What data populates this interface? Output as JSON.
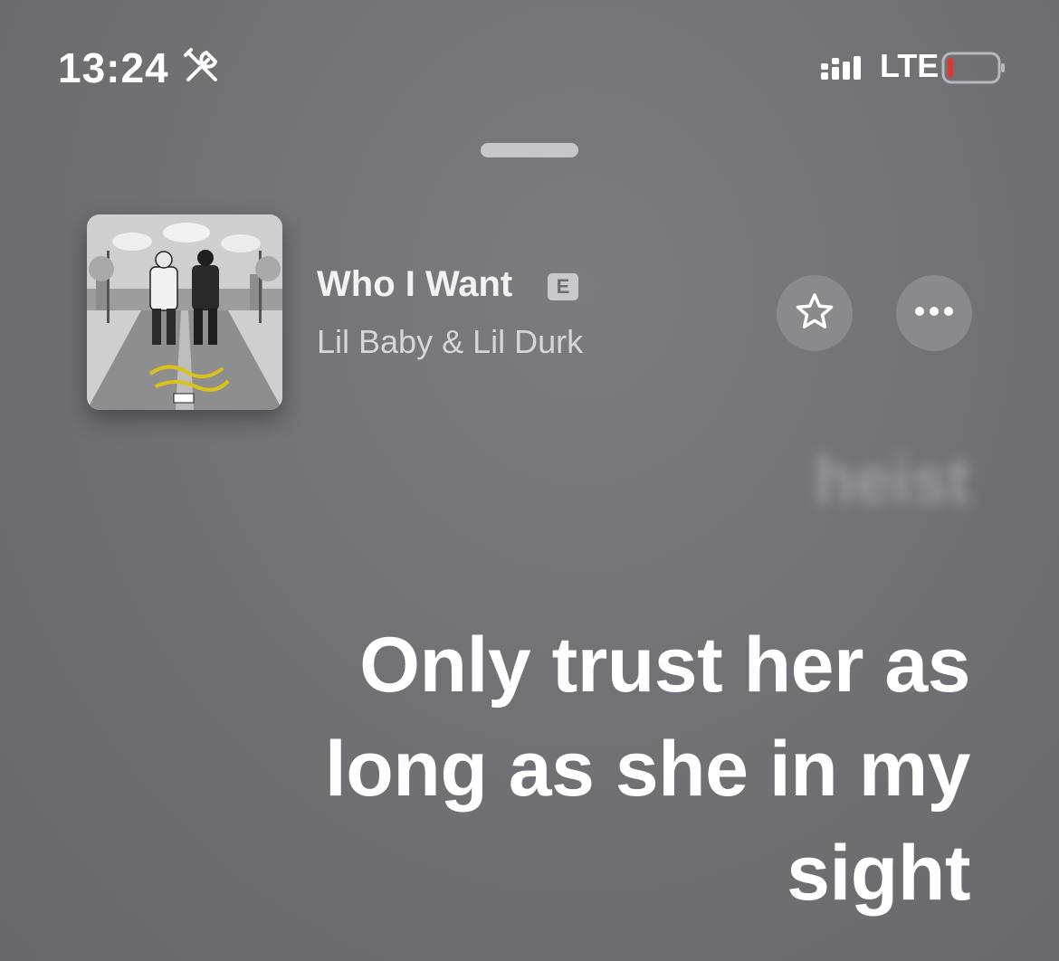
{
  "status_bar": {
    "time": "13:24",
    "network": "LTE",
    "battery_color": "#e5362d",
    "icons": [
      "tools-icon",
      "signal-icon",
      "battery-icon"
    ]
  },
  "now_playing": {
    "title": "Who I Want",
    "explicit_badge": "E",
    "artist": "Lil Baby & Lil Durk",
    "artwork_label": "album-artwork"
  },
  "actions": {
    "favorite_icon": "star-icon",
    "more_icon": "ellipsis-icon"
  },
  "lyrics": {
    "previous_line": "heist",
    "current_line": "Only trust her as long as she in my sight"
  },
  "colors": {
    "background": "#727276",
    "button_fill": "#8a8a8e",
    "text_primary": "#ffffff"
  }
}
